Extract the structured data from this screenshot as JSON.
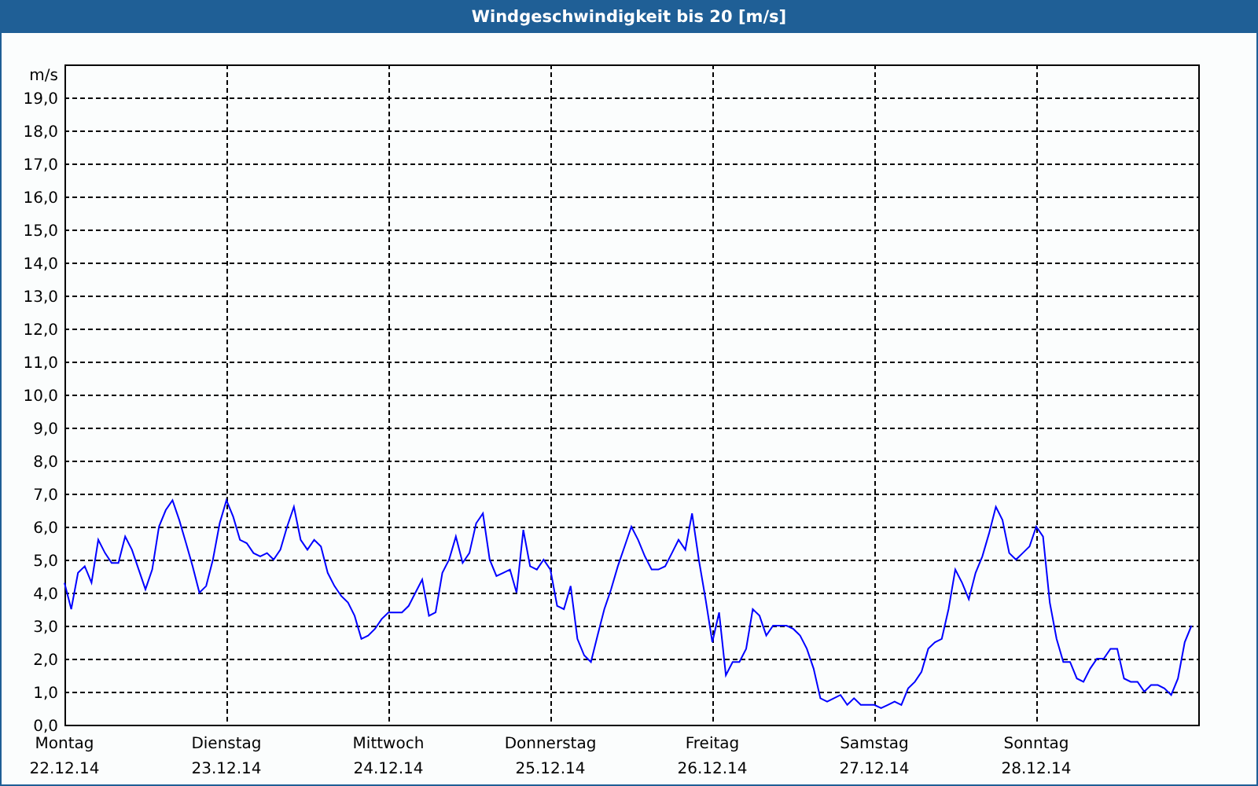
{
  "window": {
    "title": "Windgeschwindigkeit bis 20 [m/s]"
  },
  "chart_data": {
    "type": "line",
    "ylabel": "m/s",
    "ylim": [
      0,
      20
    ],
    "grid": true,
    "yticks": [
      {
        "value": 0,
        "label": "0,0"
      },
      {
        "value": 1,
        "label": "1,0"
      },
      {
        "value": 2,
        "label": "2,0"
      },
      {
        "value": 3,
        "label": "3,0"
      },
      {
        "value": 4,
        "label": "4,0"
      },
      {
        "value": 5,
        "label": "5,0"
      },
      {
        "value": 6,
        "label": "6,0"
      },
      {
        "value": 7,
        "label": "7,0"
      },
      {
        "value": 8,
        "label": "8,0"
      },
      {
        "value": 9,
        "label": "9,0"
      },
      {
        "value": 10,
        "label": "10,0"
      },
      {
        "value": 11,
        "label": "11,0"
      },
      {
        "value": 12,
        "label": "12,0"
      },
      {
        "value": 13,
        "label": "13,0"
      },
      {
        "value": 14,
        "label": "14,0"
      },
      {
        "value": 15,
        "label": "15,0"
      },
      {
        "value": 16,
        "label": "16,0"
      },
      {
        "value": 17,
        "label": "17,0"
      },
      {
        "value": 18,
        "label": "18,0"
      },
      {
        "value": 19,
        "label": "19,0"
      }
    ],
    "categories": [
      "Montag\n22.12.14",
      null,
      null,
      null,
      null,
      null,
      null,
      null,
      null,
      null,
      null,
      null,
      null,
      null,
      null,
      null,
      null,
      null,
      null,
      null,
      null,
      null,
      null,
      null,
      "Dienstag\n23.12.14",
      null,
      null,
      null,
      null,
      null,
      null,
      null,
      null,
      null,
      null,
      null,
      null,
      null,
      null,
      null,
      null,
      null,
      null,
      null,
      null,
      null,
      null,
      null,
      "Mittwoch\n24.12.14",
      null,
      null,
      null,
      null,
      null,
      null,
      null,
      null,
      null,
      null,
      null,
      null,
      null,
      null,
      null,
      null,
      null,
      null,
      null,
      null,
      null,
      null,
      null,
      "Donnerstag\n25.12.14",
      null,
      null,
      null,
      null,
      null,
      null,
      null,
      null,
      null,
      null,
      null,
      null,
      null,
      null,
      null,
      null,
      null,
      null,
      null,
      null,
      null,
      null,
      null,
      "Freitag\n26.12.14",
      null,
      null,
      null,
      null,
      null,
      null,
      null,
      null,
      null,
      null,
      null,
      null,
      null,
      null,
      null,
      null,
      null,
      null,
      null,
      null,
      null,
      null,
      null,
      "Samstag\n27.12.14",
      null,
      null,
      null,
      null,
      null,
      null,
      null,
      null,
      null,
      null,
      null,
      null,
      null,
      null,
      null,
      null,
      null,
      null,
      null,
      null,
      null,
      null,
      null,
      "Sonntag\n28.12.14",
      null,
      null,
      null,
      null,
      null,
      null,
      null,
      null,
      null,
      null,
      null,
      null,
      null,
      null,
      null,
      null,
      null,
      null,
      null,
      null,
      null,
      null,
      null
    ],
    "series": [
      {
        "color": "#0000ff",
        "values": [
          4.3,
          3.5,
          4.6,
          4.8,
          4.3,
          5.6,
          5.2,
          4.9,
          4.9,
          5.7,
          5.3,
          4.7,
          4.1,
          4.7,
          6.0,
          6.5,
          6.8,
          6.2,
          5.5,
          4.8,
          4.0,
          4.2,
          5.0,
          6.1,
          6.8,
          6.3,
          5.6,
          5.5,
          5.2,
          5.1,
          5.2,
          5.0,
          5.3,
          6.0,
          6.6,
          5.6,
          5.3,
          5.6,
          5.4,
          4.6,
          4.2,
          3.9,
          3.7,
          3.3,
          2.6,
          2.7,
          2.9,
          3.2,
          3.4,
          3.4,
          3.4,
          3.6,
          4.0,
          4.4,
          3.3,
          3.4,
          4.6,
          5.0,
          5.7,
          4.9,
          5.2,
          6.1,
          6.4,
          5.0,
          4.5,
          4.6,
          4.7,
          4.0,
          5.9,
          4.8,
          4.7,
          5.0,
          4.7,
          3.6,
          3.5,
          4.2,
          2.6,
          2.1,
          1.9,
          2.7,
          3.5,
          4.1,
          4.8,
          5.4,
          6.0,
          5.6,
          5.1,
          4.7,
          4.7,
          4.8,
          5.2,
          5.6,
          5.3,
          6.4,
          5.0,
          3.8,
          2.5,
          3.4,
          1.5,
          1.9,
          1.9,
          2.3,
          3.5,
          3.3,
          2.7,
          3.0,
          3.0,
          3.0,
          2.9,
          2.7,
          2.3,
          1.7,
          0.8,
          0.7,
          0.8,
          0.9,
          0.6,
          0.8,
          0.6,
          0.6,
          0.6,
          0.5,
          0.6,
          0.7,
          0.6,
          1.1,
          1.3,
          1.6,
          2.3,
          2.5,
          2.6,
          3.5,
          4.7,
          4.3,
          3.8,
          4.6,
          5.1,
          5.8,
          6.6,
          6.2,
          5.2,
          5.0,
          5.2,
          5.4,
          6.0,
          5.7,
          3.7,
          2.6,
          1.9,
          1.9,
          1.4,
          1.3,
          1.7,
          2.0,
          2.0,
          2.3,
          2.3,
          1.4,
          1.3,
          1.3,
          1.0,
          1.2,
          1.2,
          1.1,
          0.9,
          1.4,
          2.5,
          3.0
        ]
      }
    ]
  }
}
